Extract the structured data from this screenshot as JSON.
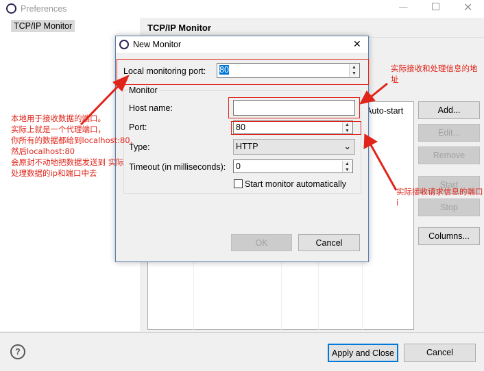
{
  "window": {
    "title": "Preferences",
    "icon": "eclipse-icon",
    "controls": [
      "minimize-icon",
      "maximize-icon",
      "close-icon"
    ]
  },
  "sidebar": {
    "items": [
      {
        "label": "TCP/IP Monitor",
        "selected": true
      }
    ]
  },
  "main": {
    "title": "TCP/IP Monitor",
    "table_header_visible": "Auto-start",
    "buttons": {
      "add": "Add...",
      "edit": "Edit...",
      "remove": "Remove",
      "start": "Start",
      "stop": "Stop",
      "columns": "Columns..."
    }
  },
  "footer": {
    "help_icon": "help-icon",
    "apply_close": "Apply and Close",
    "cancel": "Cancel"
  },
  "dialog": {
    "title": "New Monitor",
    "local_port_label": "Local monitoring port:",
    "local_port_value": "80",
    "group_label": "Monitor",
    "host_label": "Host name:",
    "host_value": "",
    "port_label": "Port:",
    "port_value": "80",
    "type_label": "Type:",
    "type_value": "HTTP",
    "timeout_label": "Timeout (in milliseconds):",
    "timeout_value": "0",
    "autostart_label": "Start monitor automatically",
    "autostart_checked": false,
    "ok": "OK",
    "cancel": "Cancel"
  },
  "annotations": {
    "left": [
      "本地用于接收数据的端口。",
      "实际上就是一个代理端口，",
      "你所有的数据都给到localhost:80,",
      "然后localhost:80",
      "会原封不动地把数据发送到 实际",
      "处理数据的ip和端口中去"
    ],
    "host": "实际接收和处理信息的地址",
    "port": "实际接收请求信息的端口i",
    "color": "#e0241a"
  }
}
